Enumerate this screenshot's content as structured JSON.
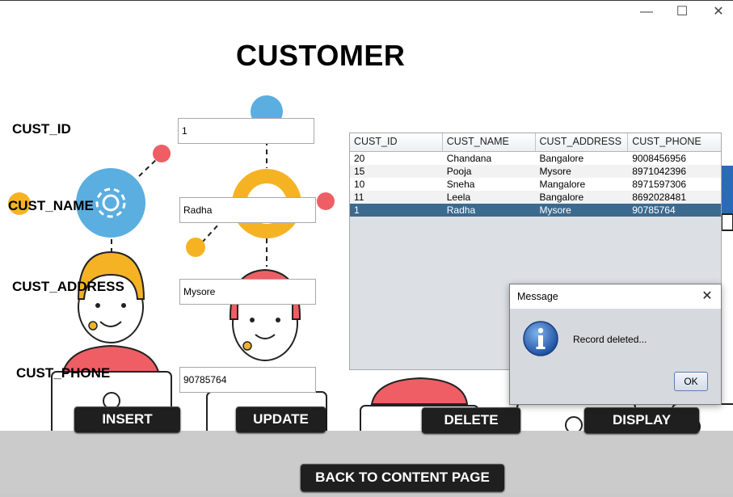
{
  "window": {
    "minimize_glyph": "—",
    "maximize_glyph": "☐",
    "close_glyph": "✕"
  },
  "page_title": "CUSTOMER",
  "form": {
    "id_label": "CUST_ID",
    "id_value": "1",
    "name_label": "CUST_NAME",
    "name_value": "Radha",
    "address_label": "CUST_ADDRESS",
    "address_value": "Mysore",
    "phone_label": "CUST_PHONE",
    "phone_value": "90785764"
  },
  "table": {
    "headers": [
      "CUST_ID",
      "CUST_NAME",
      "CUST_ADDRESS",
      "CUST_PHONE"
    ],
    "rows": [
      [
        "20",
        "Chandana",
        "Bangalore",
        "9008456956"
      ],
      [
        "15",
        "Pooja",
        "Mysore",
        "8971042396"
      ],
      [
        "10",
        "Sneha",
        "Mangalore",
        "8971597306"
      ],
      [
        "11",
        "Leela",
        "Bangalore",
        "8692028481"
      ],
      [
        "1",
        "Radha",
        "Mysore",
        "90785764"
      ]
    ],
    "selected_row": 4
  },
  "buttons": {
    "insert": "INSERT",
    "update": "UPDATE",
    "delete": "DELETE",
    "display": "DISPLAY",
    "back": "BACK TO CONTENT PAGE"
  },
  "dialog": {
    "title": "Message",
    "message": "Record deleted...",
    "ok": "OK",
    "icon": "info-icon"
  },
  "colors": {
    "illustration_blue": "#5aaee0",
    "illustration_yellow": "#f5b324",
    "illustration_red": "#ef5e64",
    "selected_row": "#3c6a8f",
    "button_dark": "#1f1f1f"
  }
}
